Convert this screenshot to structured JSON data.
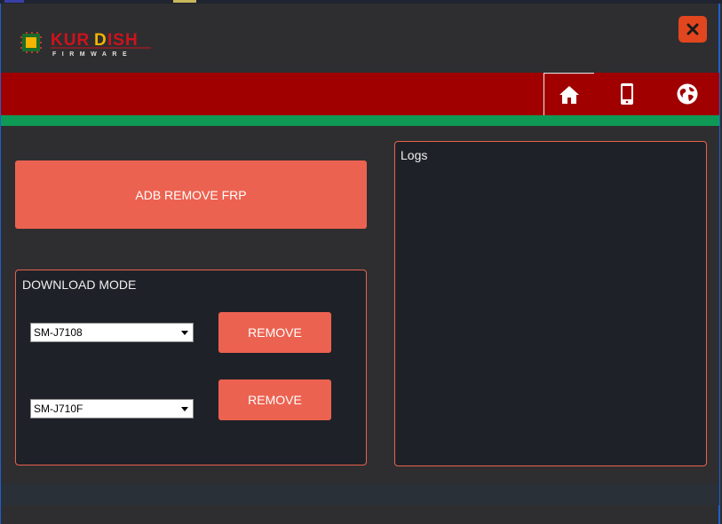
{
  "app": {
    "logo_text_main": "KURDISH",
    "logo_text_sub": "FIRMWARE"
  },
  "colors": {
    "accent": "#ec6250",
    "header_red": "#a00000",
    "header_green": "#0e9a55",
    "close": "#e2461f",
    "panel_bg": "#1f2128"
  },
  "header": {
    "close_icon": "close-icon",
    "nav": [
      {
        "icon": "home-icon",
        "active": true
      },
      {
        "icon": "phone-icon",
        "active": false
      },
      {
        "icon": "globe-icon",
        "active": false
      }
    ]
  },
  "main": {
    "adb_button_label": "ADB REMOVE FRP",
    "download_mode": {
      "title": "DOWNLOAD MODE",
      "rows": [
        {
          "model": "SM-J7108",
          "button_label": "REMOVE"
        },
        {
          "model": "SM-J710F",
          "button_label": "REMOVE"
        }
      ]
    },
    "logs": {
      "title": "Logs"
    }
  }
}
